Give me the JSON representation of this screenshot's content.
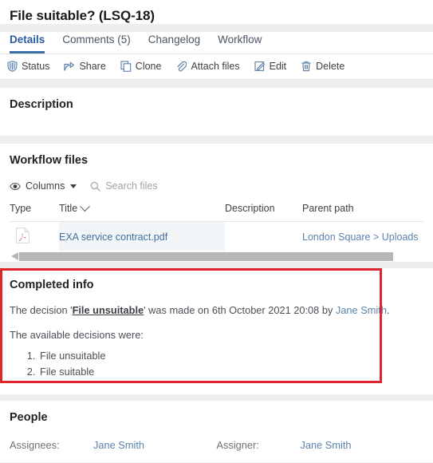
{
  "header": {
    "title": "File suitable? (LSQ-18)"
  },
  "tabs": [
    {
      "label": "Details",
      "active": true
    },
    {
      "label": "Comments (5)",
      "active": false
    },
    {
      "label": "Changelog",
      "active": false
    },
    {
      "label": "Workflow",
      "active": false
    }
  ],
  "toolbar": [
    {
      "label": "Status",
      "icon": "status-icon"
    },
    {
      "label": "Share",
      "icon": "share-icon"
    },
    {
      "label": "Clone",
      "icon": "clone-icon"
    },
    {
      "label": "Attach files",
      "icon": "paperclip-icon"
    },
    {
      "label": "Edit",
      "icon": "pencil-icon"
    },
    {
      "label": "Delete",
      "icon": "trash-icon"
    }
  ],
  "description": {
    "title": "Description",
    "body": ""
  },
  "workflow_files": {
    "title": "Workflow files",
    "columns_button": "Columns",
    "search_placeholder": "Search files",
    "search_value": "",
    "headers": {
      "type": "Type",
      "title": "Title",
      "description": "Description",
      "parent_path": "Parent path"
    },
    "rows": [
      {
        "type_icon": "pdf-file-icon",
        "title": "EXA service contract.pdf",
        "description": "",
        "parent_path": "London Square > Uploads"
      }
    ]
  },
  "completed_info": {
    "title": "Completed info",
    "decision_prefix": "The decision '",
    "decision_value": "File unsuitable",
    "decision_middle": "' was made on 6th October 2021 20:08 by ",
    "decision_person": "Jane Smith",
    "decision_suffix": ".",
    "available_label": "The available decisions were:",
    "available_decisions": [
      "File unsuitable",
      "File suitable"
    ],
    "highlight_color": "#e0262c"
  },
  "people": {
    "title": "People",
    "assignees_label": "Assignees:",
    "assignees_value": "Jane Smith",
    "assigner_label": "Assigner:",
    "assigner_value": "Jane Smith"
  },
  "colors": {
    "accent": "#3a6ea5",
    "link": "#5b83ad",
    "highlight": "#e0262c",
    "page_bg": "#eeeeee"
  }
}
